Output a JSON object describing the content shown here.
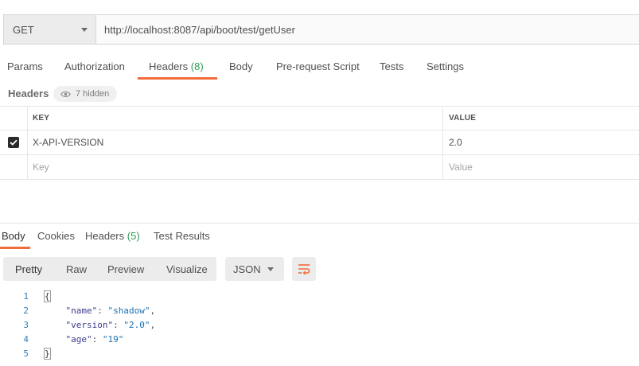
{
  "request": {
    "method": "GET",
    "url": "http://localhost:8087/api/boot/test/getUser"
  },
  "request_tabs": [
    {
      "label": "Params",
      "count": ""
    },
    {
      "label": "Authorization",
      "count": ""
    },
    {
      "label": "Headers",
      "count": "(8)"
    },
    {
      "label": "Body",
      "count": ""
    },
    {
      "label": "Pre-request Script",
      "count": ""
    },
    {
      "label": "Tests",
      "count": ""
    },
    {
      "label": "Settings",
      "count": ""
    }
  ],
  "active_request_tab": "Headers",
  "headers_section": {
    "label": "Headers",
    "hidden_label": "7 hidden"
  },
  "headers_table": {
    "columns": [
      "KEY",
      "VALUE"
    ],
    "rows": [
      {
        "checked": true,
        "key": "X-API-VERSION",
        "value": "2.0"
      }
    ],
    "placeholder": {
      "key": "Key",
      "value": "Value"
    }
  },
  "response_tabs": [
    {
      "label": "Body",
      "count": ""
    },
    {
      "label": "Cookies",
      "count": ""
    },
    {
      "label": "Headers",
      "count": "(5)"
    },
    {
      "label": "Test Results",
      "count": ""
    }
  ],
  "active_response_tab": "Body",
  "view_modes": [
    "Pretty",
    "Raw",
    "Preview",
    "Visualize"
  ],
  "format": "JSON",
  "response_body": [
    {
      "n": "1",
      "parts": [
        {
          "t": "{",
          "c": "brace"
        }
      ]
    },
    {
      "n": "2",
      "parts": [
        {
          "t": "    ",
          "c": ""
        },
        {
          "t": "\"name\"",
          "c": "k"
        },
        {
          "t": ": ",
          "c": "punct"
        },
        {
          "t": "\"shadow\"",
          "c": "s"
        },
        {
          "t": ",",
          "c": "punct"
        }
      ]
    },
    {
      "n": "3",
      "parts": [
        {
          "t": "    ",
          "c": ""
        },
        {
          "t": "\"version\"",
          "c": "k"
        },
        {
          "t": ": ",
          "c": "punct"
        },
        {
          "t": "\"2.0\"",
          "c": "s"
        },
        {
          "t": ",",
          "c": "punct"
        }
      ]
    },
    {
      "n": "4",
      "parts": [
        {
          "t": "    ",
          "c": ""
        },
        {
          "t": "\"age\"",
          "c": "k"
        },
        {
          "t": ": ",
          "c": "punct"
        },
        {
          "t": "\"19\"",
          "c": "s"
        }
      ]
    },
    {
      "n": "5",
      "parts": [
        {
          "t": "}",
          "c": "brace"
        }
      ]
    }
  ],
  "colors": {
    "accent": "#f26b3a",
    "count_green": "#2f9b57",
    "line_number": "#2f7fb5"
  }
}
